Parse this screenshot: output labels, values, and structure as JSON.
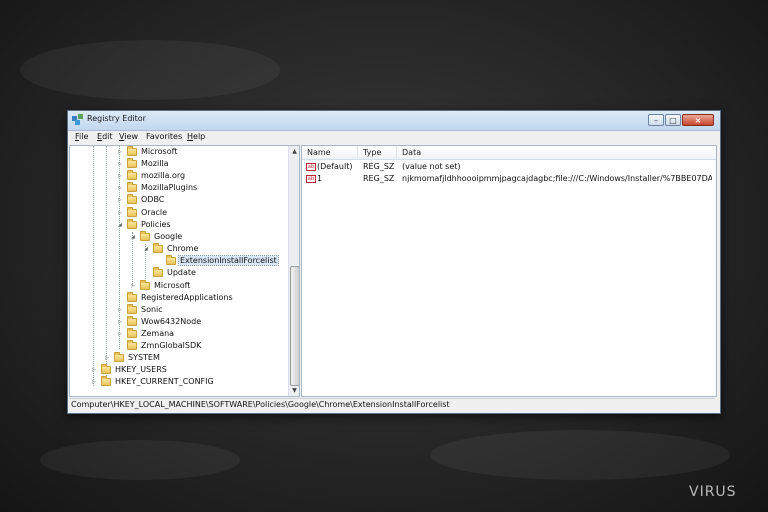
{
  "window": {
    "title": "Registry Editor"
  },
  "menu": [
    {
      "key": "F",
      "rest": "ile"
    },
    {
      "key": "E",
      "rest": "dit"
    },
    {
      "key": "V",
      "rest": "iew"
    },
    {
      "key": "",
      "rest": "Favorites"
    },
    {
      "key": "H",
      "rest": "elp"
    }
  ],
  "tree": [
    {
      "label": "Microsoft"
    },
    {
      "label": "Mozilla"
    },
    {
      "label": "mozilla.org"
    },
    {
      "label": "MozillaPlugins"
    },
    {
      "label": "ODBC"
    },
    {
      "label": "Oracle"
    },
    {
      "label": "Policies"
    },
    {
      "label": "Google"
    },
    {
      "label": "Chrome"
    },
    {
      "label": "ExtensionInstallForcelist"
    },
    {
      "label": "Update"
    },
    {
      "label": "Microsoft"
    },
    {
      "label": "RegisteredApplications"
    },
    {
      "label": "Sonic"
    },
    {
      "label": "Wow6432Node"
    },
    {
      "label": "Zemana"
    },
    {
      "label": "ZmnGlobalSDK"
    },
    {
      "label": "SYSTEM"
    },
    {
      "label": "HKEY_USERS"
    },
    {
      "label": "HKEY_CURRENT_CONFIG"
    }
  ],
  "columns": {
    "name": "Name",
    "type": "Type",
    "data": "Data"
  },
  "values": [
    {
      "name": "(Default)",
      "type": "REG_SZ",
      "data": "(value not set)",
      "icon": "ab"
    },
    {
      "name": "1",
      "type": "REG_SZ",
      "data": "njkmomafjldhhoooipmmjpagcajdagbc;file:///C:/Windows/Installer/%7BBE07DAEA...",
      "icon": "ab"
    }
  ],
  "status": "Computer\\HKEY_LOCAL_MACHINE\\SOFTWARE\\Policies\\Google\\Chrome\\ExtensionInstallForcelist",
  "watermark": {
    "main": "VIRUS",
    "accent": ""
  }
}
